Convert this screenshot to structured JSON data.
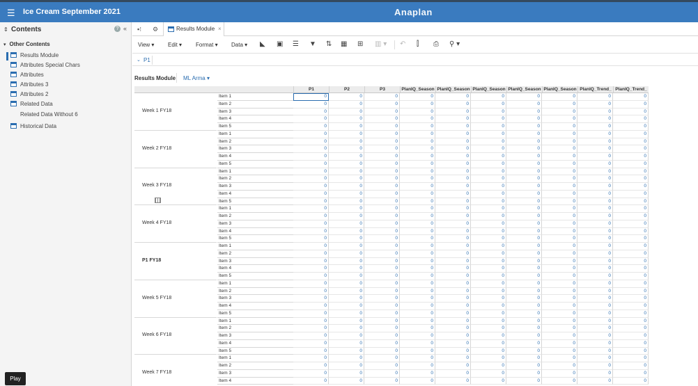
{
  "app": {
    "title": "Ice Cream September 2021",
    "logo": "Anaplan"
  },
  "sidebar": {
    "header": "Contents",
    "section": "Other Contents",
    "items": [
      {
        "label": "Results Module",
        "icon": "module-icon",
        "active": true
      },
      {
        "label": "Attributes Special Chars",
        "icon": "module-icon"
      },
      {
        "label": "Attributes",
        "icon": "module-icon"
      },
      {
        "label": "Attributes 3",
        "icon": "module-icon"
      },
      {
        "label": "Attributes 2",
        "icon": "module-icon"
      },
      {
        "label": "Related Data",
        "icon": "module-icon"
      },
      {
        "label": "Related Data Without 6",
        "icon": "grid-icon",
        "indent": true
      },
      {
        "label": "Historical Data",
        "icon": "module-icon"
      }
    ],
    "play_label": "Play"
  },
  "tabs": {
    "active_label": "Results Module",
    "close": "×"
  },
  "toolbar": {
    "menus": [
      "View",
      "Edit",
      "Format",
      "Data"
    ]
  },
  "filter": {
    "value": "P1"
  },
  "grid": {
    "module_name": "Results Module",
    "page_selector": "ML Arma",
    "columns": [
      "P1",
      "P2",
      "P3",
      "PlanIQ_Season",
      "PlanIQ_Season",
      "PlanIQ_Season",
      "PlanIQ_Season",
      "PlanIQ_Season",
      "PlanIQ_Trend_",
      "PlanIQ_Trend_"
    ],
    "row_groups": [
      {
        "label": "Week 1 FY18",
        "bold": false
      },
      {
        "label": "Week 2 FY18",
        "bold": false
      },
      {
        "label": "Week 3 FY18",
        "bold": false
      },
      {
        "label": "Week 4 FY18",
        "bold": false
      },
      {
        "label": "P1 FY18",
        "bold": true
      },
      {
        "label": "Week 5 FY18",
        "bold": false
      },
      {
        "label": "Week 6 FY18",
        "bold": false
      },
      {
        "label": "Week 7 FY18",
        "bold": false
      }
    ],
    "items": [
      "Item 1",
      "Item 2",
      "Item 3",
      "Item 4",
      "Item 5"
    ],
    "cell_value": "0"
  },
  "colors": {
    "topbar": "#3a7bbf",
    "accent": "#2a6db0"
  }
}
